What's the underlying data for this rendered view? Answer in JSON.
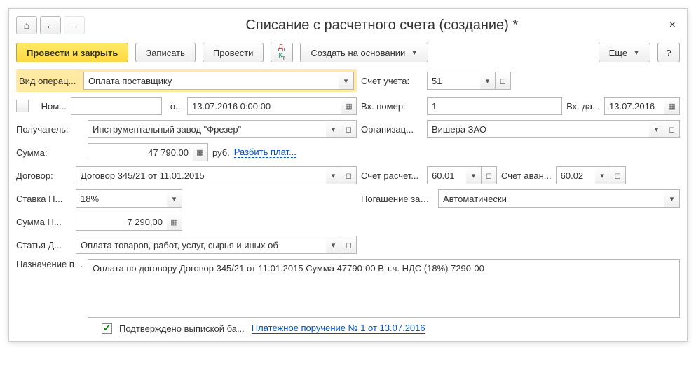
{
  "title": "Списание с расчетного счета (создание) *",
  "toolbar": {
    "postClose": "Провести и закрыть",
    "save": "Записать",
    "post": "Провести",
    "createBased": "Создать на основании",
    "more": "Еще",
    "help": "?"
  },
  "labels": {
    "opType": "Вид операц...",
    "account": "Счет учета:",
    "num": "Ном...",
    "ot": "о...",
    "extNum": "Вх. номер:",
    "extDate": "Вх. да...",
    "payee": "Получатель:",
    "org": "Организац...",
    "sum": "Сумма:",
    "rub": "руб.",
    "split": "Разбить плат...",
    "contract": "Договор:",
    "acctSettle": "Счет расчет...",
    "acctAdvance": "Счет аван...",
    "vatRate": "Ставка Н...",
    "debt": "Погашение задолженно...",
    "vatSum": "Сумма Н...",
    "article": "Статья Д...",
    "purpose": "Назначение платежа:",
    "confirmed": "Подтверждено выпиской ба...",
    "orderLink": "Платежное поручение № 1 от 13.07.2016"
  },
  "values": {
    "opType": "Оплата поставщику",
    "account": "51",
    "num": "",
    "date": "13.07.2016  0:00:00",
    "extNum": "1",
    "extDate": "13.07.2016",
    "payee": "Инструментальный завод \"Фрезер\"",
    "org": "Вишера ЗАО",
    "sum": "47 790,00",
    "contract": "Договор 345/21 от 11.01.2015",
    "acctSettle": "60.01",
    "acctAdvance": "60.02",
    "vatRate": "18%",
    "debt": "Автоматически",
    "vatSum": "7 290,00",
    "article": "Оплата товаров, работ, услуг, сырья и иных об",
    "purpose": "Оплата по договору Договор 345/21 от 11.01.2015 Сумма 47790-00 В т.ч. НДС  (18%) 7290-00"
  }
}
